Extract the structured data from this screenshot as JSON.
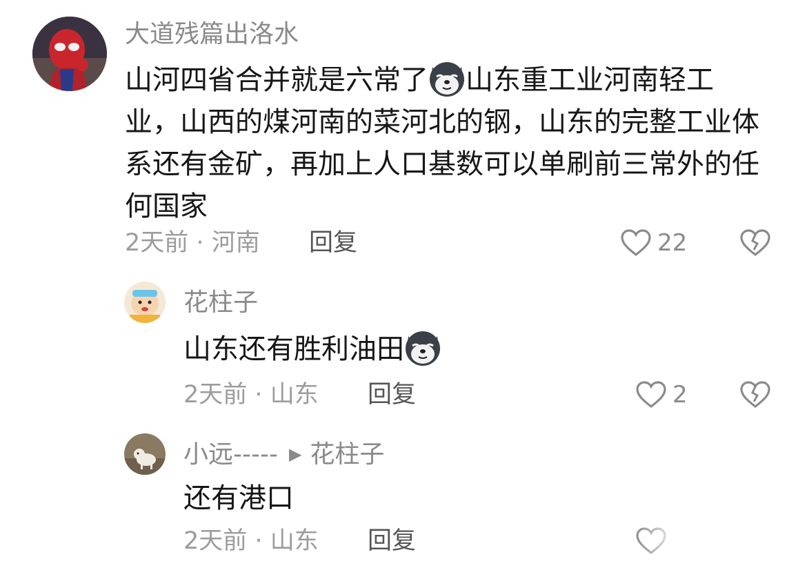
{
  "comments": [
    {
      "username": "大道残篇出洛水",
      "content_part1": "山河四省合并就是六常了",
      "content_part2": "山东重工业河南轻工业，山西的煤河南的菜河北的钢，山东的完整工业体系还有金矿，再加上人口基数可以单刷前三常外的任何国家",
      "emoji": "dog-emoji-icon",
      "time": "2天前",
      "location": "河南",
      "reply_label": "回复",
      "likes": "22"
    },
    {
      "username": "花柱子",
      "content": "山东还有胜利油田",
      "emoji": "dog-emoji-icon",
      "time": "2天前",
      "location": "山东",
      "reply_label": "回复",
      "likes": "2"
    },
    {
      "username": "小远-----",
      "reply_to": "花柱子",
      "content": "还有港口",
      "time": "2天前",
      "location": "山东",
      "reply_label": "回复",
      "likes": ""
    }
  ],
  "separator": "·",
  "reply_arrow": "▶",
  "colors": {
    "name": "#8a8a8a",
    "text": "#161616",
    "meta": "#9c9c9c",
    "reply": "#555555"
  }
}
